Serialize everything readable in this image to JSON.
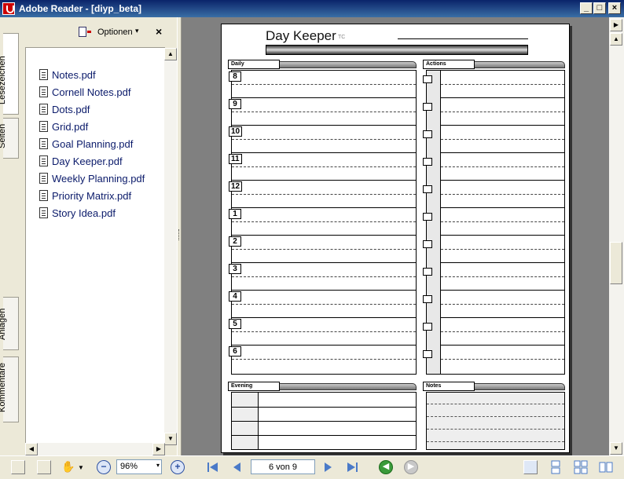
{
  "window": {
    "title": "Adobe Reader - [diyp_beta]",
    "min": "_",
    "max": "□",
    "close": "×"
  },
  "side_tabs": {
    "bookmarks": "Lesezeichen",
    "pages": "Seiten",
    "attachments": "Anlagen",
    "comments": "Kommentare"
  },
  "panel": {
    "options_label": "Optionen",
    "options_caret": "▾",
    "close": "×",
    "bookmarks": [
      {
        "label": "Notes.pdf"
      },
      {
        "label": "Cornell Notes.pdf"
      },
      {
        "label": "Dots.pdf"
      },
      {
        "label": "Grid.pdf"
      },
      {
        "label": "Goal Planning.pdf"
      },
      {
        "label": "Day Keeper.pdf"
      },
      {
        "label": "Weekly Planning.pdf"
      },
      {
        "label": "Priority Matrix.pdf"
      },
      {
        "label": "Story Idea.pdf"
      }
    ]
  },
  "document": {
    "title": "Day Keeper",
    "tc": "TC",
    "daily_label": "Daily",
    "actions_label": "Actions",
    "evening_label": "Evening",
    "notes_label": "Notes",
    "hours": [
      "8",
      "9",
      "10",
      "11",
      "12",
      "1",
      "2",
      "3",
      "4",
      "5",
      "6"
    ]
  },
  "toolbar": {
    "zoom_value": "96%",
    "zoom_caret": "▾",
    "page_indicator": "6 von 9"
  },
  "scroll": {
    "up": "▲",
    "down": "▼",
    "left": "◀",
    "right": "▶"
  }
}
